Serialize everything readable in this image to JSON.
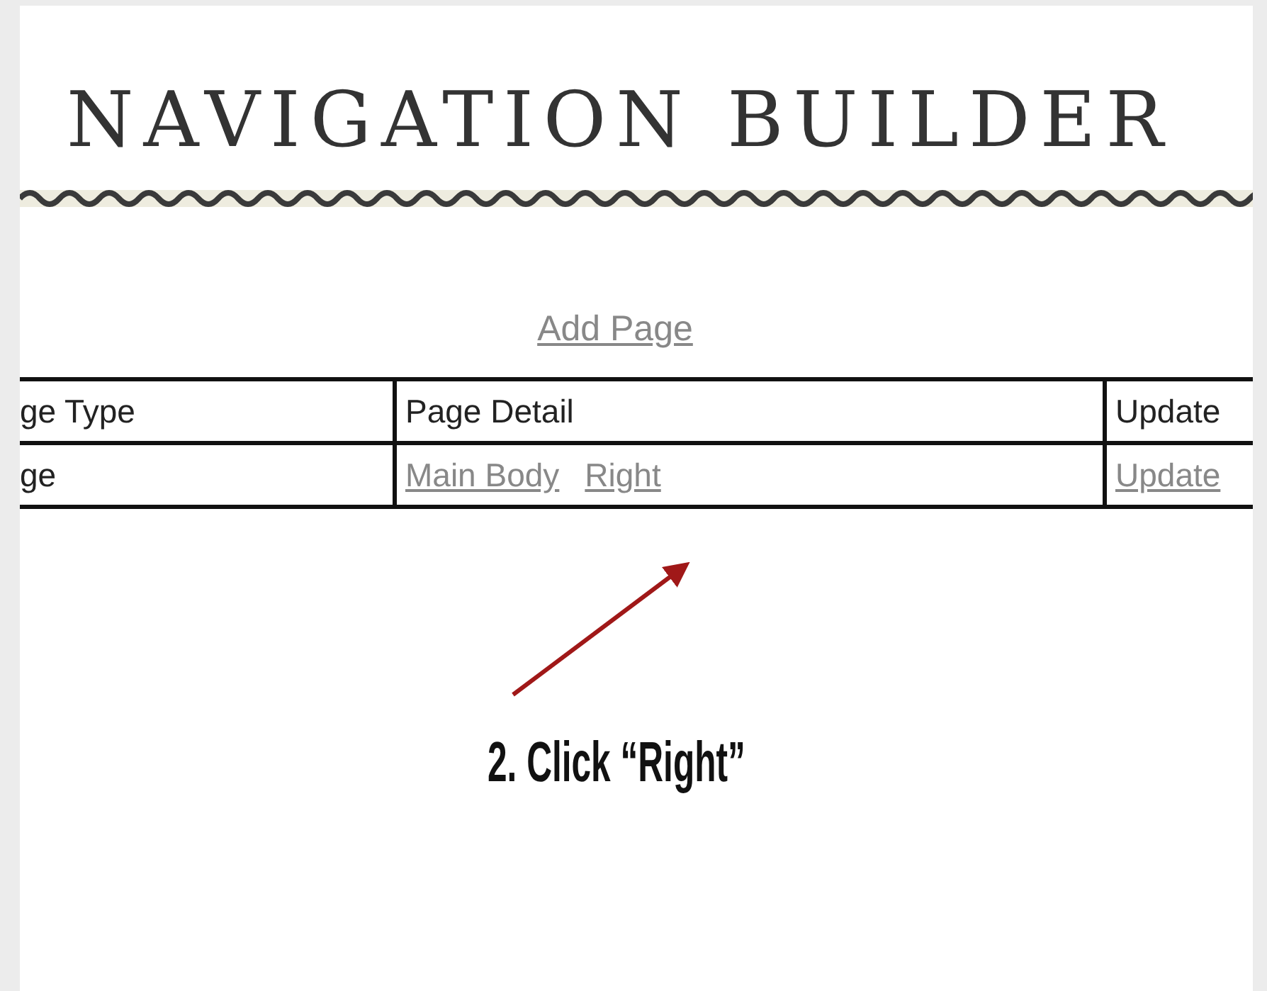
{
  "title": "NAVIGATION BUILDER",
  "add_link": "Add Page",
  "table": {
    "columns": [
      "ge Type",
      "Page Detail",
      "Update"
    ],
    "rows": [
      {
        "cells": [
          {
            "kind": "text",
            "text": "ge"
          },
          {
            "kind": "links",
            "links": [
              "Main Body",
              "Right"
            ]
          },
          {
            "kind": "links",
            "links": [
              "Update"
            ]
          }
        ]
      }
    ]
  },
  "annotation": {
    "caption": "2. Click “Right”"
  }
}
